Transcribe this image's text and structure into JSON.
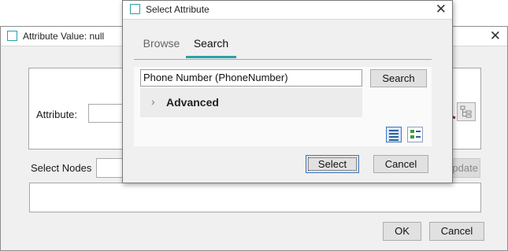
{
  "background_dialog": {
    "title": "Attribute Value: null",
    "close": "✕",
    "attribute_label": "Attribute:",
    "select_nodes_label": "Select Nodes",
    "update_label": "Update",
    "ok_label": "OK",
    "cancel_label": "Cancel"
  },
  "select_dialog": {
    "title": "Select Attribute",
    "close": "✕",
    "tabs": [
      {
        "label": "Browse",
        "selected": false
      },
      {
        "label": "Search",
        "selected": true
      }
    ],
    "query_value": "Phone Number (PhoneNumber)",
    "search_label": "Search",
    "advanced_chevron": "›",
    "advanced_label": "Advanced",
    "select_label": "Select",
    "cancel_label": "Cancel"
  },
  "colors": {
    "accent": "#2aa1a8",
    "arrow": "#a3222c"
  },
  "icons": [
    "window-icon",
    "close-icon",
    "chevron-right-icon",
    "list-view-icon",
    "detail-view-icon",
    "tree-icon"
  ]
}
